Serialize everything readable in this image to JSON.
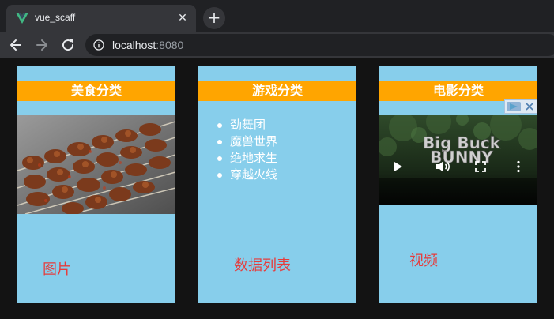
{
  "browser": {
    "tab": {
      "title": "vue_scaff",
      "favicon": "vue-logo-icon",
      "close_icon": "close-icon"
    },
    "new_tab_icon": "plus-icon",
    "nav": {
      "back": "arrow-left-icon",
      "forward": "arrow-right-icon",
      "reload": "reload-icon"
    },
    "address": {
      "host": "localhost",
      "port": ":8080",
      "security_icon": "info-icon"
    }
  },
  "panels": {
    "food": {
      "title": "美食分类",
      "footer": "图片",
      "image_icon": "food-skewers-image"
    },
    "games": {
      "title": "游戏分类",
      "items": [
        "劲舞团",
        "魔兽世界",
        "绝地求生",
        "穿越火线"
      ],
      "footer": "数据列表"
    },
    "movies": {
      "title": "电影分类",
      "footer": "视频",
      "video": {
        "poster_title_line1": "Big Buck",
        "poster_title_line2": "BUNNY"
      },
      "controls": {
        "play": "play-icon",
        "volume": "volume-icon",
        "fullscreen": "fullscreen-icon",
        "more": "more-vert-icon"
      },
      "ad_badge_icon": "ad-choices-icon"
    }
  },
  "colors": {
    "panel_bg": "#87ceeb",
    "panel_header": "#ffa500",
    "footer_text": "#e63c3c",
    "page_bg": "#131313"
  }
}
